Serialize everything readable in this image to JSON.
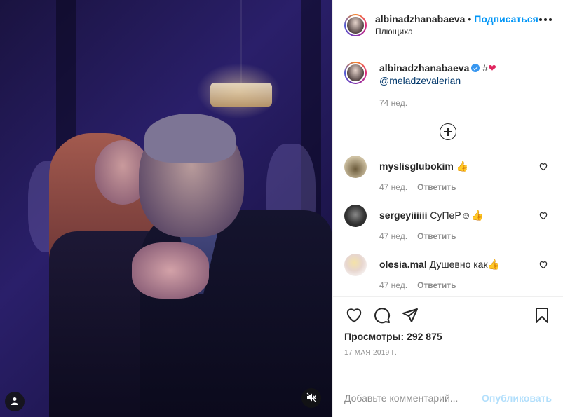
{
  "header": {
    "username": "albinadzhanabaeva",
    "separator": "•",
    "follow_label": "Подписаться",
    "location": "Плющиха",
    "more_icon": "more-horizontal-icon"
  },
  "caption": {
    "username": "albinadzhanabaeva",
    "verified": true,
    "text_hash": "#",
    "text_heart": "❤",
    "mention": "@meladzevalerian",
    "age": "74 нед."
  },
  "load_more_icon": "plus-circle-icon",
  "comments": [
    {
      "username": "myslisglubokim",
      "text": "👍",
      "age": "47 нед.",
      "reply_label": "Ответить"
    },
    {
      "username": "sergeyiiiiii",
      "text": "СуПеР☺👍",
      "age": "47 нед.",
      "reply_label": "Ответить"
    },
    {
      "username": "olesia.mal",
      "text": "Душевно как👍",
      "age": "47 нед.",
      "reply_label": "Ответить"
    }
  ],
  "actions": {
    "views_label": "Просмотры:",
    "views_count": "292 875",
    "date": "17 МАЯ 2019 Г."
  },
  "composer": {
    "placeholder": "Добавьте комментарий...",
    "publish_label": "Опубликовать"
  },
  "colors": {
    "accent": "#0095f6",
    "publish_disabled": "#b2dffc",
    "muted": "#8e8e8e",
    "text": "#262626"
  }
}
